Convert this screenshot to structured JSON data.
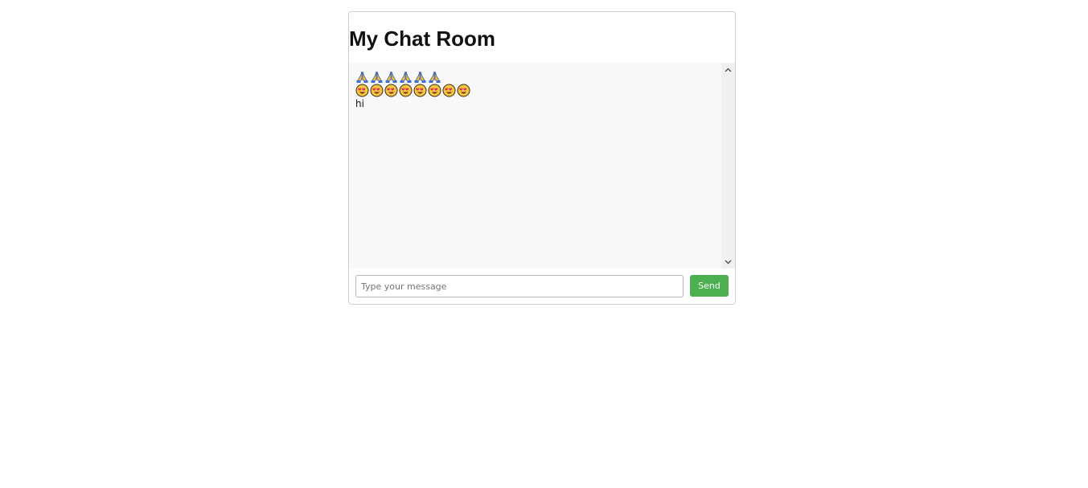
{
  "header": {
    "title": "My Chat Room"
  },
  "messages": [
    {
      "type": "emoji",
      "emoji": "folded-hands",
      "count": 6,
      "glyph": "🙏🙏🙏🙏🙏🙏"
    },
    {
      "type": "emoji",
      "emoji": "smiling-face-with-heart-eyes",
      "count": 8,
      "glyph": "😍😍😍😍😍😍😍😍"
    },
    {
      "type": "text",
      "text": "hi"
    }
  ],
  "composer": {
    "placeholder": "Type your message",
    "value": "",
    "send_label": "Send"
  },
  "colors": {
    "accent": "#4caf50",
    "pane_background": "#f8f8f8"
  }
}
